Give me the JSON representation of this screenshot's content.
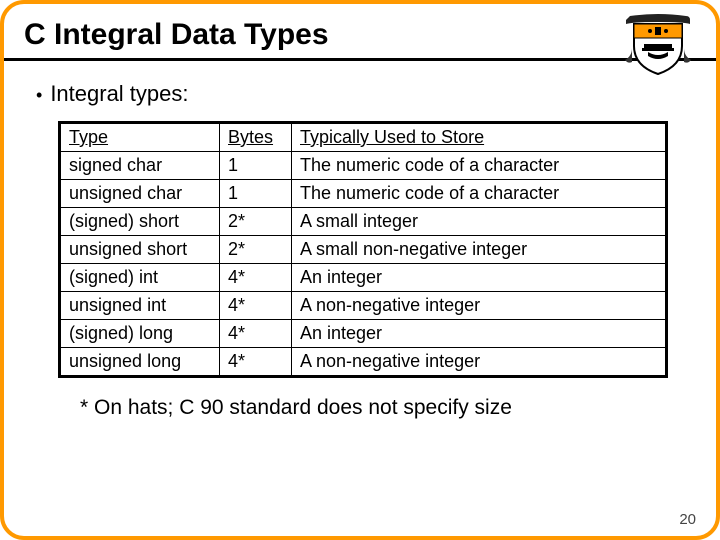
{
  "title": "C Integral Data Types",
  "bullet": "Integral types:",
  "table": {
    "headers": {
      "type": "Type",
      "bytes": "Bytes",
      "use": "Typically Used to Store"
    },
    "rows": [
      {
        "type": "signed char",
        "bytes": "1",
        "use": "The numeric code of a character"
      },
      {
        "type": "unsigned char",
        "bytes": "1",
        "use": "The numeric code of a character"
      },
      {
        "type": "(signed) short",
        "bytes": "2*",
        "use": "A small integer"
      },
      {
        "type": "unsigned short",
        "bytes": "2*",
        "use": "A small non-negative integer"
      },
      {
        "type": "(signed) int",
        "bytes": "4*",
        "use": "An integer"
      },
      {
        "type": "unsigned int",
        "bytes": "4*",
        "use": "A non-negative integer"
      },
      {
        "type": "(signed) long",
        "bytes": "4*",
        "use": "An integer"
      },
      {
        "type": "unsigned long",
        "bytes": "4*",
        "use": "A non-negative integer"
      }
    ]
  },
  "footnote": "* On hats; C 90 standard does not specify size",
  "page_number": "20",
  "crest_alt": "university-shield"
}
